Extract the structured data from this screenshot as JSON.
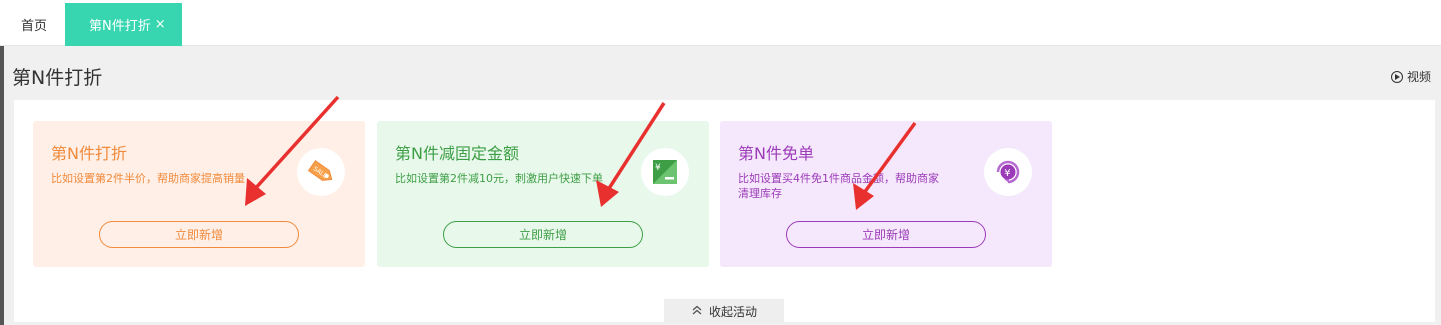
{
  "tabs": {
    "home": "首页",
    "active": "第N件打折",
    "close": "×"
  },
  "header": {
    "title": "第N件打折",
    "video": "视频"
  },
  "cards": [
    {
      "title": "第N件打折",
      "desc": "比如设置第2件半价，帮助商家提高销量",
      "button": "立即新增",
      "icon": "sale-tag-icon",
      "color": "#f08a3c"
    },
    {
      "title": "第N件减固定金额",
      "desc": "比如设置第2件减10元，刺激用户快速下单",
      "button": "立即新增",
      "icon": "yen-discount-icon",
      "color": "#3e9e45"
    },
    {
      "title": "第N件免单",
      "desc": "比如设置买4件免1件商品金额，帮助商家清理库存",
      "button": "立即新增",
      "icon": "yen-refresh-icon",
      "color": "#9b3bb8"
    }
  ],
  "collapse": {
    "label": "收起活动"
  },
  "colors": {
    "tab_active": "#38d6b0",
    "arrow": "#e8312f"
  }
}
